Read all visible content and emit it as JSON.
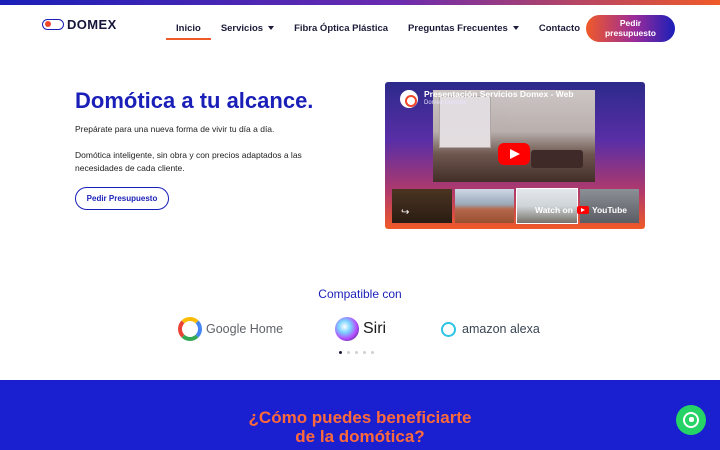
{
  "header": {
    "logo_text": "DOMEX",
    "nav": [
      {
        "label": "Inicio"
      },
      {
        "label": "Servicios"
      },
      {
        "label": "Fibra Óptica Plástica"
      },
      {
        "label": "Preguntas Frecuentes"
      },
      {
        "label": "Contacto"
      }
    ],
    "cta_line1": "Pedir",
    "cta_line2": "presupuesto"
  },
  "hero": {
    "title": "Domótica a tu alcance.",
    "paragraph1": "Prepárate para una nueva forma de vivir tu día a día.",
    "paragraph2": "Domótica inteligente, sin obra y con precios adaptados a las necesidades de cada cliente.",
    "button": "Pedir Presupuesto"
  },
  "video": {
    "title": "Presentación Servicios Domex - Web",
    "channel": "Domex Domotic",
    "watch_on": "Watch on",
    "platform": "YouTube"
  },
  "compatible": {
    "title": "Compatible con",
    "brands": [
      {
        "name": "Google Home",
        "icon": "google-icon"
      },
      {
        "name": "Siri",
        "icon": "siri-icon"
      },
      {
        "name": "amazon alexa",
        "icon": "alexa-icon"
      }
    ],
    "carousel_pages": 5,
    "carousel_active": 1
  },
  "benefits": {
    "title_line1": "¿Cómo puedes beneficiarte",
    "title_line2": "de la domótica?"
  },
  "colors": {
    "primary": "#1a1fb8",
    "accent": "#f05a28",
    "section_bg": "#1a1fd0",
    "whatsapp": "#25d366"
  }
}
